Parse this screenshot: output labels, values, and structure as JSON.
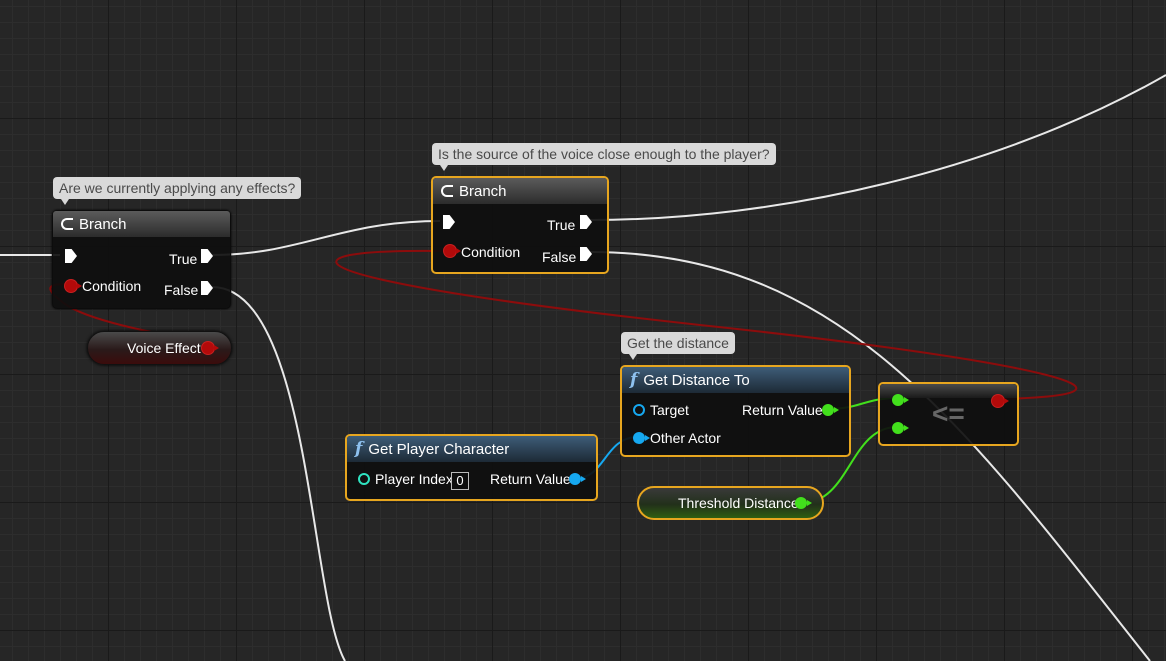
{
  "comments": {
    "branch1": "Are we currently applying any effects?",
    "branch2": "Is the source of the voice close enough to the player?",
    "distance": "Get the distance"
  },
  "branch1": {
    "title": "Branch",
    "true_label": "True",
    "false_label": "False",
    "condition_label": "Condition"
  },
  "branch2": {
    "title": "Branch",
    "true_label": "True",
    "false_label": "False",
    "condition_label": "Condition"
  },
  "voice_effect": {
    "label": "Voice Effect"
  },
  "get_distance": {
    "title": "Get Distance To",
    "target_label": "Target",
    "other_actor_label": "Other Actor",
    "return_label": "Return Value"
  },
  "get_player": {
    "title": "Get Player Character",
    "player_index_label": "Player Index",
    "player_index_value": "0",
    "return_label": "Return Value"
  },
  "compare": {
    "symbol": "<="
  },
  "threshold": {
    "label": "Threshold Distance"
  },
  "colors": {
    "exec": "#ffffff",
    "bool": "#b30a0a",
    "object": "#16a8f0",
    "float": "#42e01c",
    "selected_border": "#e7a61f"
  },
  "icons": {
    "branch": "branch-icon",
    "function": "function-f-icon"
  }
}
